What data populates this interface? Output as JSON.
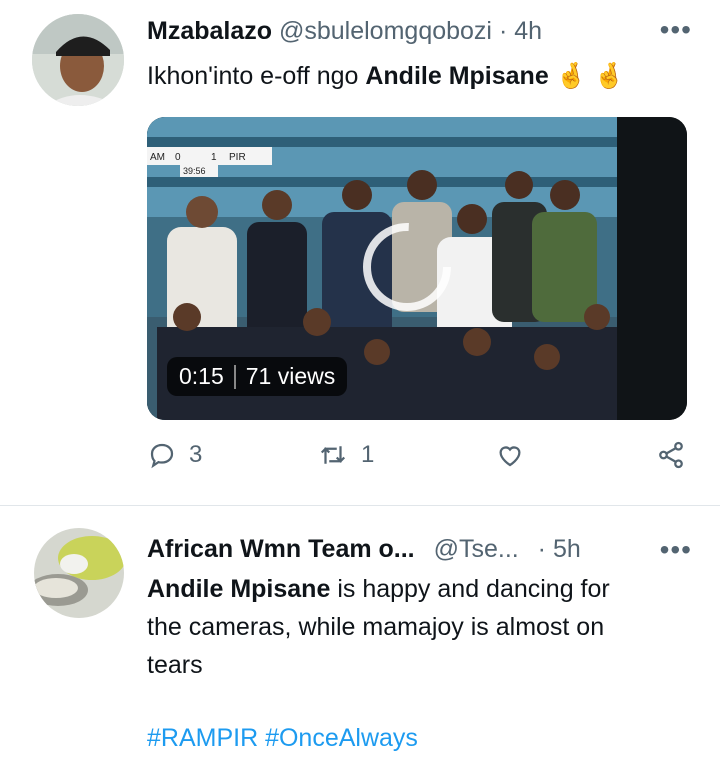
{
  "tweet1": {
    "name": "Mzabalazo",
    "handle": "@sbulelomgqobozi",
    "dot": "·",
    "time": "4h",
    "more": "•••",
    "text_prefix": "Ikhon'into e-off ngo ",
    "text_bold": "Andile Mpisane",
    "text_emoji": "🤞 🤞",
    "video": {
      "duration": "0:15",
      "views": "71 views",
      "scoreboard_left": "AM",
      "score_left": "0",
      "score_right": "1",
      "scoreboard_right": "PIR",
      "clock": "39:56"
    },
    "replies": "3",
    "retweets": "1"
  },
  "tweet2": {
    "name": "African Wmn Team o...",
    "handle": "@Tse...",
    "dot": "·",
    "time": "5h",
    "more": "•••",
    "text_bold": "Andile Mpisane",
    "text_line1_rest": " is happy and dancing for",
    "text_line2": "the cameras, while mamajoy is almost on",
    "text_line3": "tears",
    "hashtags": "#RAMPIR #OnceAlways"
  },
  "colors": {
    "accent": "#1d9bf0",
    "muted": "#536471",
    "text": "#0f1419"
  }
}
